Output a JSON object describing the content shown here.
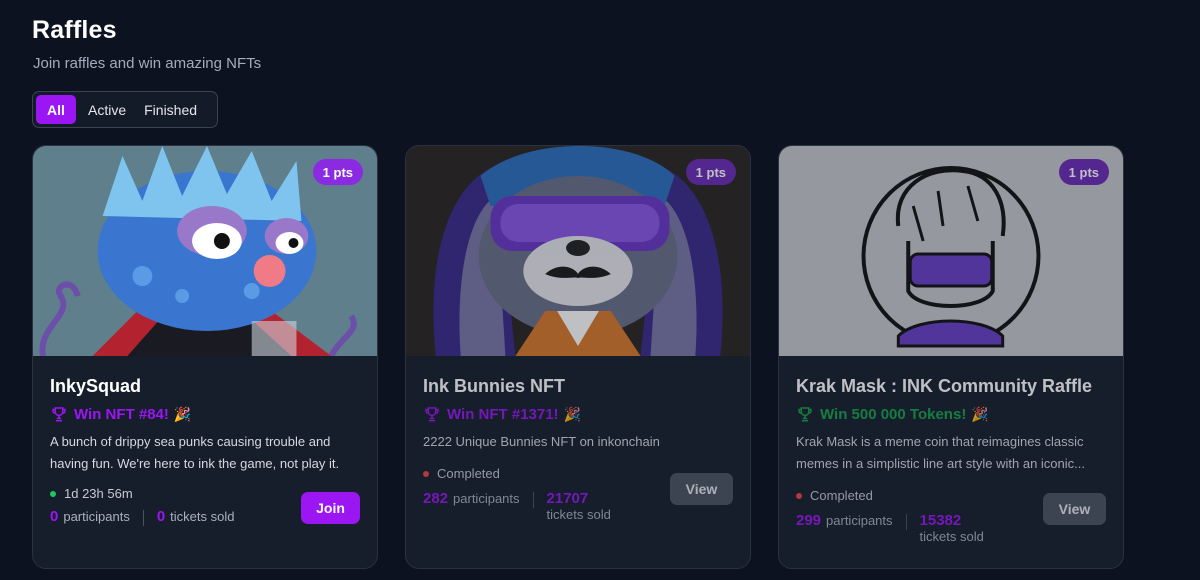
{
  "header": {
    "title": "Raffles",
    "subtitle": "Join raffles and win amazing NFTs"
  },
  "filters": [
    {
      "label": "All",
      "active": true
    },
    {
      "label": "Active",
      "active": false
    },
    {
      "label": "Finished",
      "active": false
    }
  ],
  "colors": {
    "accent": "#9b16f2",
    "active_dot": "#22c55e",
    "completed_dot": "#ef4444",
    "tokens_green": "#16a34a"
  },
  "raffles": [
    {
      "title": "InkySquad",
      "points": "1 pts",
      "prize": "Win NFT #84!",
      "prize_icon": "trophy-icon",
      "party_icon": "🎉",
      "description": "A bunch of drippy sea punks causing trouble and having fun. We're here to ink the game, not play it.",
      "status": "1d 23h 56m",
      "participants_count": "0",
      "participants_label": "participants",
      "tickets_count": "0",
      "tickets_label": "tickets sold",
      "action_label": "Join"
    },
    {
      "title": "Ink Bunnies NFT",
      "points": "1 pts",
      "prize": "Win NFT #1371!",
      "prize_icon": "trophy-icon",
      "party_icon": "🎉",
      "description": "2222 Unique Bunnies NFT on inkonchain",
      "status": "Completed",
      "participants_count": "282",
      "participants_label": "participants",
      "tickets_count": "21707",
      "tickets_label": "tickets sold",
      "action_label": "View"
    },
    {
      "title": "Krak Mask : INK Community Raffle",
      "points": "1 pts",
      "prize": "Win 500 000 Tokens!",
      "prize_icon": "trophy-icon",
      "party_icon": "🎉",
      "description": "Krak Mask is a meme coin that reimagines classic memes in a simplistic line art style with an iconic...",
      "status": "Completed",
      "participants_count": "299",
      "participants_label": "participants",
      "tickets_count": "15382",
      "tickets_label": "tickets sold",
      "action_label": "View"
    }
  ]
}
